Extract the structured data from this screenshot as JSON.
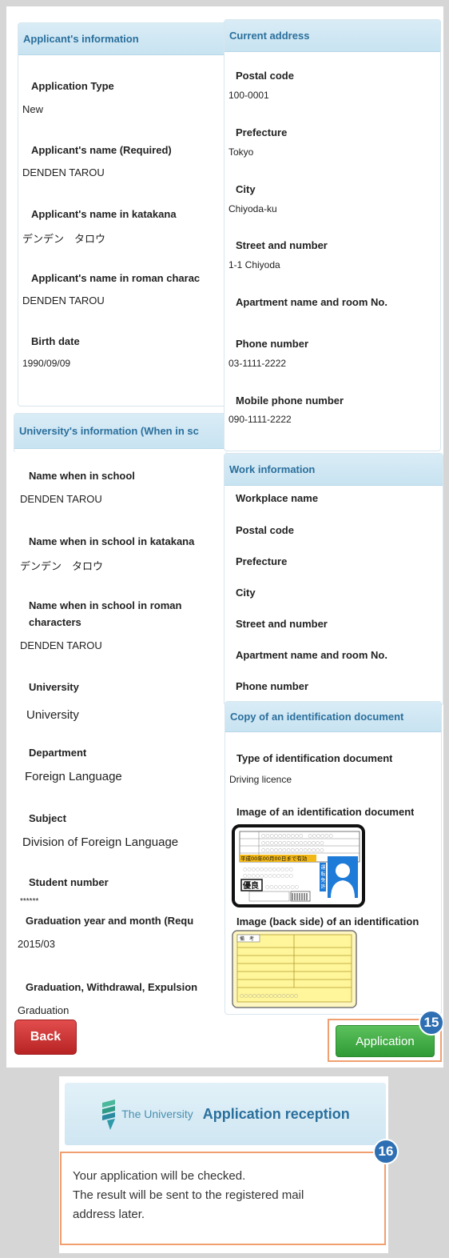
{
  "applicant": {
    "header": "Applicant's information",
    "fields": [
      {
        "label": "Application Type",
        "value": "New"
      },
      {
        "label": "Applicant's name (Required)",
        "value": "DENDEN TAROU"
      },
      {
        "label": "Applicant's name in katakana",
        "value": "デンデン　タロウ"
      },
      {
        "label": "Applicant's name in roman charac",
        "value": "DENDEN TAROU"
      },
      {
        "label": "Birth date",
        "value": "1990/09/09"
      }
    ]
  },
  "current_address": {
    "header": "Current address",
    "fields": [
      {
        "label": "Postal code",
        "value": "100-0001"
      },
      {
        "label": "Prefecture",
        "value": "Tokyo"
      },
      {
        "label": "City",
        "value": "Chiyoda-ku"
      },
      {
        "label": "Street and number",
        "value": "1-1 Chiyoda"
      },
      {
        "label": "Apartment name and room No.",
        "value": ""
      },
      {
        "label": "Phone number",
        "value": "03-1111-2222"
      },
      {
        "label": "Mobile phone number",
        "value": "090-1111-2222"
      }
    ]
  },
  "university": {
    "header": "University's information (When in sc",
    "fields": [
      {
        "label": "Name when in school",
        "value": "DENDEN TAROU"
      },
      {
        "label": "Name when in school in katakana",
        "value": "デンデン　タロウ"
      },
      {
        "label": "Name when in school in roman",
        "label2": "characters",
        "value": "DENDEN TAROU"
      },
      {
        "label": "University",
        "value": "University"
      },
      {
        "label": "Department",
        "value": "Foreign Language"
      },
      {
        "label": "Subject",
        "value": "Division of Foreign Language"
      },
      {
        "label": "Student number",
        "value": "******"
      },
      {
        "label": "Graduation year and month (Requ",
        "value": "2015/03"
      },
      {
        "label": "Graduation, Withdrawal, Expulsion",
        "value": "Graduation"
      }
    ]
  },
  "work": {
    "header": "Work information",
    "labels": [
      "Workplace name",
      "Postal code",
      "Prefecture",
      "City",
      "Street and number",
      "Apartment name and room No.",
      "Phone number"
    ]
  },
  "identification": {
    "header": "Copy of an identification document",
    "type_label": "Type of identification document",
    "type_value": "Driving licence",
    "image_label": "Image of an identification document",
    "back_label": "Image (back side) of an identification",
    "card_front_text": "平成00年00月00日まで有効",
    "card_front_side": "運転免許証",
    "card_badge": "優良",
    "card_back_header": "備　考"
  },
  "buttons": {
    "back": "Back",
    "application": "Application"
  },
  "badges": {
    "step15": "15",
    "step16": "16"
  },
  "reception": {
    "logo_text": "The University",
    "title": "Application reception",
    "message_line1": "Your application will be checked.",
    "message_line2": "The result will be sent to the registered mail",
    "message_line3": "address later."
  },
  "colors": {
    "header_text": "#2a6f9c",
    "back_button": "#c83232",
    "application_button": "#3aa23e",
    "badge": "#2e6fb3",
    "highlight": "#f0a070"
  }
}
